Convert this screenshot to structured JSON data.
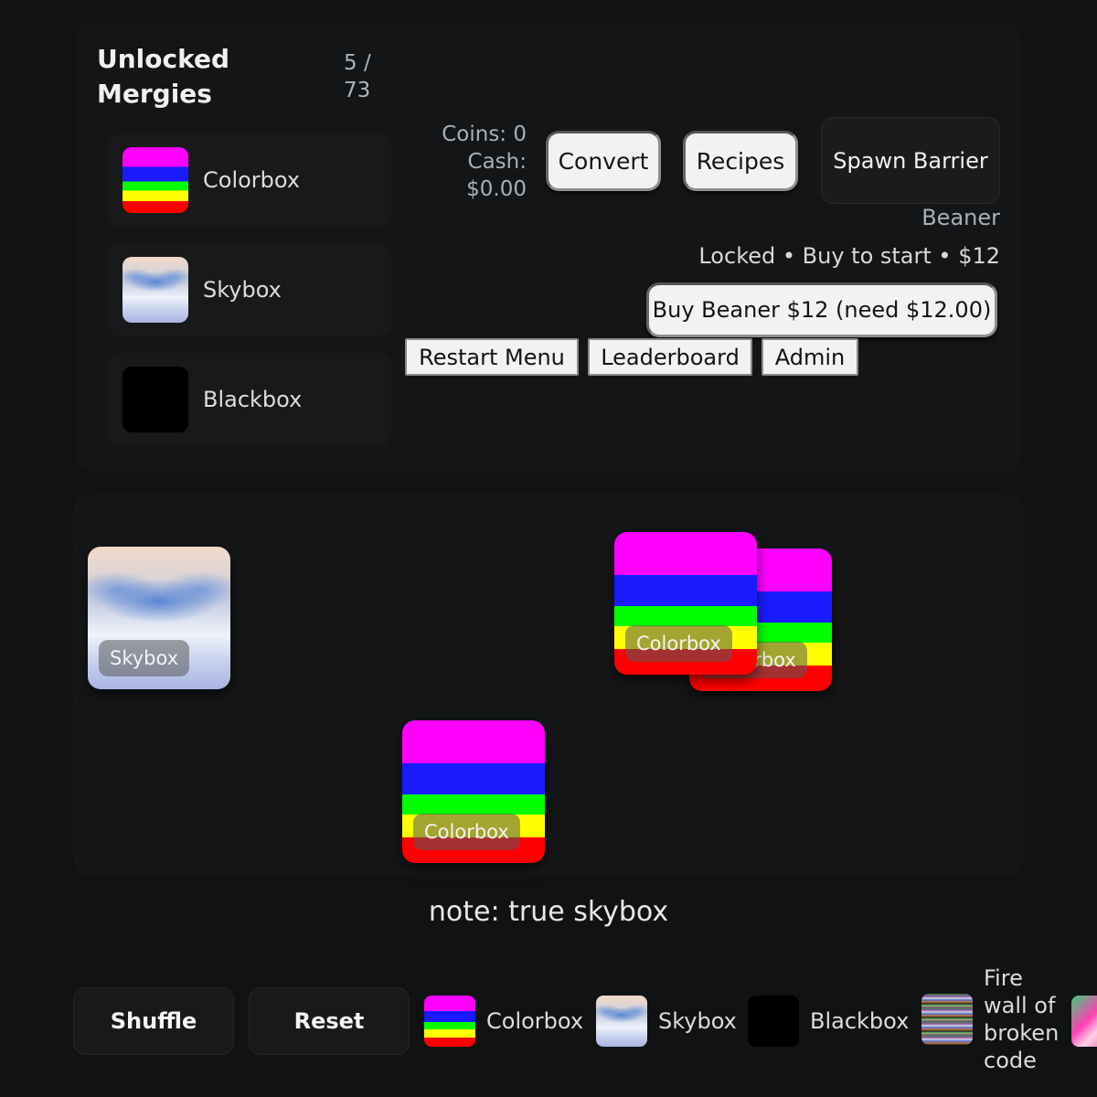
{
  "sidebar": {
    "title": "Unlocked Mergies",
    "count": "5 / 73",
    "items": [
      {
        "label": "Colorbox",
        "icon": "colorbox-texture"
      },
      {
        "label": "Skybox",
        "icon": "skybox-texture"
      },
      {
        "label": "Blackbox",
        "icon": "blackbox-texture"
      }
    ]
  },
  "stats": {
    "coins": "Coins: 0",
    "cash_label": "Cash:",
    "cash_value": "$0.00"
  },
  "toolbar": {
    "convert": "Convert",
    "recipes": "Recipes",
    "spawn_barrier": "Spawn Barrier",
    "restart_menu": "Restart Menu",
    "leaderboard": "Leaderboard",
    "admin": "Admin"
  },
  "shop": {
    "name": "Beaner",
    "status": "Locked • Buy to start • $12",
    "buy_label": "Buy Beaner $12 (need $12.00)"
  },
  "board": {
    "cards": [
      {
        "label": "Skybox"
      },
      {
        "label": "Colorbox"
      },
      {
        "label": "Colorbox"
      },
      {
        "label": "Colorbox"
      }
    ]
  },
  "note": "note: true skybox",
  "bottom": {
    "shuffle": "Shuffle",
    "reset": "Reset",
    "tray": [
      {
        "label": "Colorbox"
      },
      {
        "label": "Skybox"
      },
      {
        "label": "Blackbox"
      },
      {
        "label": "Fire wall of broken code"
      }
    ]
  },
  "colors": {
    "background": "#111214",
    "panel": "#141517",
    "button_light": "#f2f2f2",
    "muted_text": "#a6b1b8"
  }
}
